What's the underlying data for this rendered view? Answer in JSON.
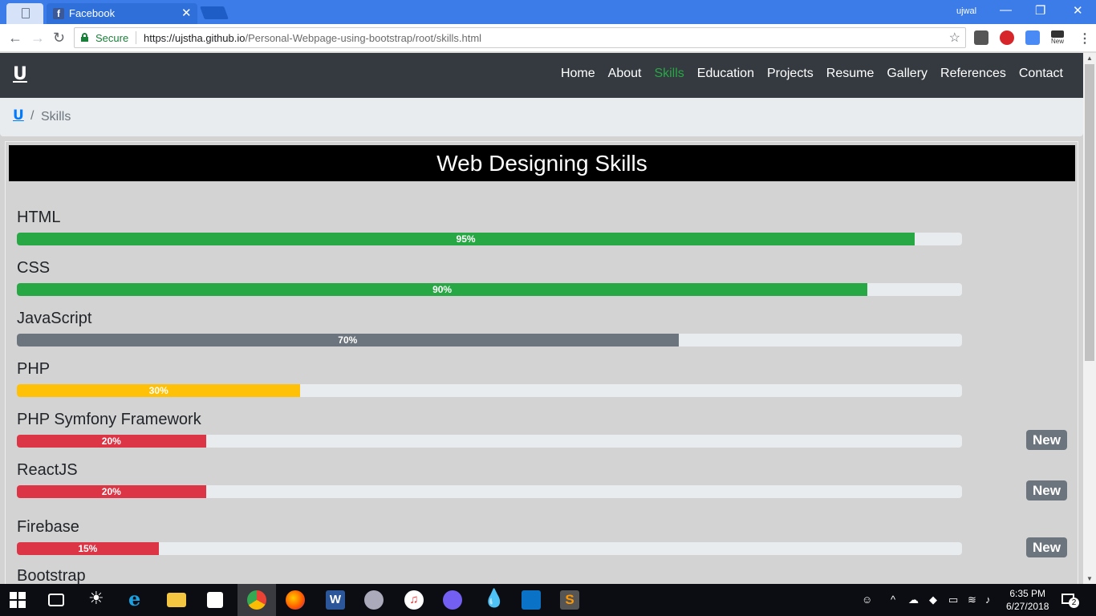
{
  "browser": {
    "tab_title": "Facebook",
    "tab_favicon_letter": "f",
    "close_tab": "✕",
    "user": "ujwal",
    "minimize": "—",
    "restore": "❐",
    "close": "✕",
    "secure_label": "Secure",
    "url_host": "https://ujstha.github.io",
    "url_path": "/Personal-Webpage-using-bootstrap/root/skills.html",
    "ext_new_label": "New"
  },
  "navbar": {
    "brand": "U",
    "links": [
      "Home",
      "About",
      "Skills",
      "Education",
      "Projects",
      "Resume",
      "Gallery",
      "References",
      "Contact"
    ],
    "active": "Skills"
  },
  "breadcrumb": {
    "home": "U",
    "separator": "/",
    "current": "Skills"
  },
  "section": {
    "title": "Web Designing Skills"
  },
  "skills": [
    {
      "name": "HTML",
      "percent": 95,
      "label": "95%",
      "color": "#28a745",
      "badge": ""
    },
    {
      "name": "CSS",
      "percent": 90,
      "label": "90%",
      "color": "#28a745",
      "badge": ""
    },
    {
      "name": "JavaScript",
      "percent": 70,
      "label": "70%",
      "color": "#6c757d",
      "badge": ""
    },
    {
      "name": "PHP",
      "percent": 30,
      "label": "30%",
      "color": "#ffc107",
      "badge": ""
    },
    {
      "name": "PHP Symfony Framework",
      "percent": 20,
      "label": "20%",
      "color": "#dc3545",
      "badge": "New"
    },
    {
      "name": "ReactJS",
      "percent": 20,
      "label": "20%",
      "color": "#dc3545",
      "badge": "New"
    },
    {
      "name": "Firebase",
      "percent": 15,
      "label": "15%",
      "color": "#dc3545",
      "badge": "New"
    },
    {
      "name": "Bootstrap",
      "percent": 0,
      "label": "",
      "color": "#28a745",
      "badge": ""
    }
  ],
  "taskbar": {
    "time": "6:35 PM",
    "date": "6/27/2018",
    "notifications": "2"
  }
}
